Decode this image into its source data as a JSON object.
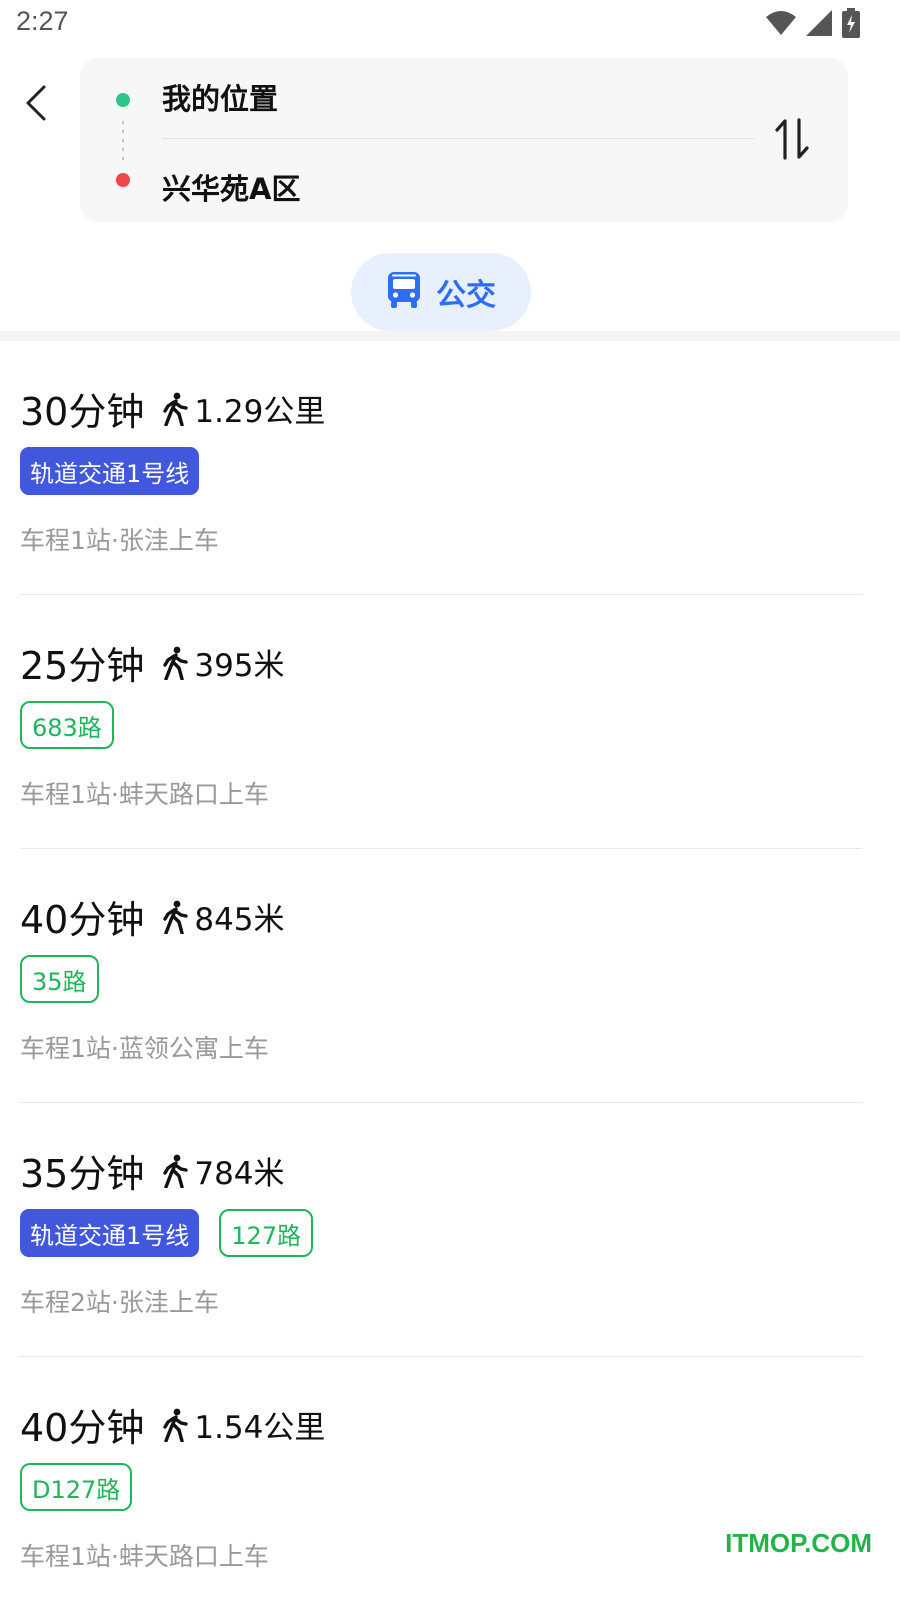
{
  "status_bar": {
    "time": "2:27",
    "icons": [
      "wifi-icon",
      "signal-icon",
      "battery-charging-icon"
    ]
  },
  "header": {
    "back_icon": "chevron-left-icon",
    "origin": "我的位置",
    "destination": "兴华苑A区",
    "swap_icon": "swap-vertical-icon"
  },
  "mode_tab": {
    "label": "公交",
    "icon": "bus-icon",
    "accent_color": "#2e6ef7"
  },
  "colors": {
    "rail_tag": "#4157dc",
    "bus_tag": "#1fb55a",
    "origin_dot": "#2ec58a",
    "destination_dot": "#f04848"
  },
  "routes": [
    {
      "time": "30分钟",
      "walk": "1.29公里",
      "tags": [
        {
          "label": "轨道交通1号线",
          "type": "rail"
        }
      ],
      "desc": "车程1站·张洼上车"
    },
    {
      "time": "25分钟",
      "walk": "395米",
      "tags": [
        {
          "label": "683路",
          "type": "bus"
        }
      ],
      "desc": "车程1站·蚌天路口上车"
    },
    {
      "time": "40分钟",
      "walk": "845米",
      "tags": [
        {
          "label": "35路",
          "type": "bus"
        }
      ],
      "desc": "车程1站·蓝领公寓上车"
    },
    {
      "time": "35分钟",
      "walk": "784米",
      "tags": [
        {
          "label": "轨道交通1号线",
          "type": "rail"
        },
        {
          "label": "127路",
          "type": "bus"
        }
      ],
      "desc": "车程2站·张洼上车"
    },
    {
      "time": "40分钟",
      "walk": "1.54公里",
      "tags": [
        {
          "label": "D127路",
          "type": "bus"
        }
      ],
      "desc": "车程1站·蚌天路口上车"
    }
  ],
  "watermark": "ITMOP.COM"
}
